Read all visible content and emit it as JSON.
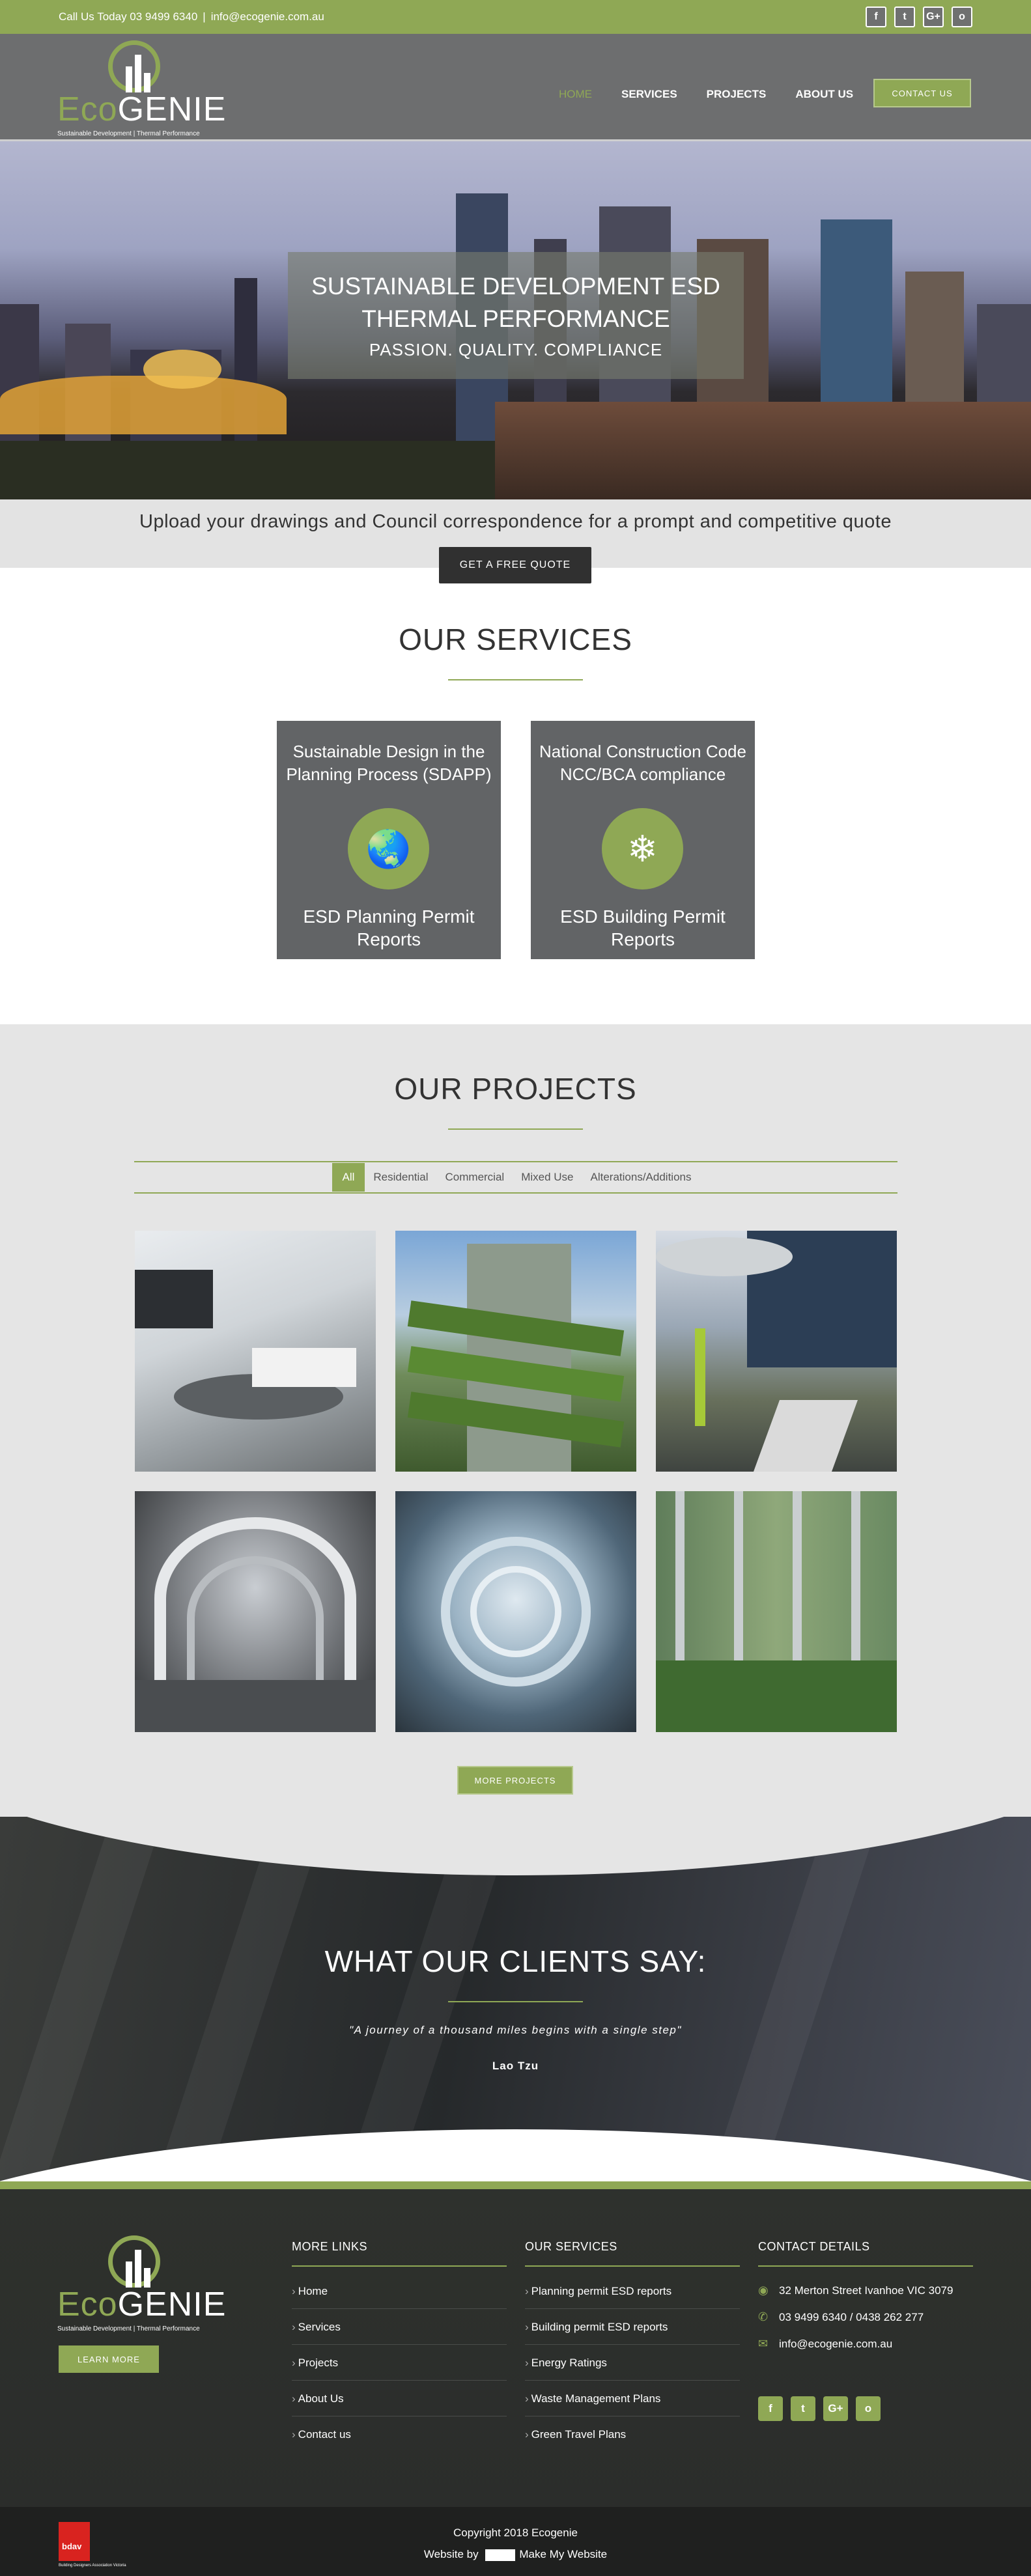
{
  "topbar": {
    "call_text": "Call Us Today 03 9499 6340",
    "email": "info@ecogenie.com.au",
    "social": [
      "f",
      "t",
      "G+",
      "o"
    ]
  },
  "logo": {
    "eco": "Eco",
    "genie": "GENIE",
    "tagline": "Sustainable Development | Thermal Performance"
  },
  "nav": {
    "items": [
      "HOME",
      "SERVICES",
      "PROJECTS",
      "ABOUT US"
    ],
    "contact_button": "CONTACT US"
  },
  "hero": {
    "title_line1": "SUSTAINABLE DEVELOPMENT ESD",
    "title_line2": "THERMAL PERFORMANCE",
    "subtitle": "PASSION. QUALITY. COMPLIANCE"
  },
  "quote": {
    "text": "Upload your drawings and Council correspondence for a prompt and competitive quote",
    "button": "GET A FREE QUOTE"
  },
  "services": {
    "heading": "OUR SERVICES",
    "cards": [
      {
        "top_line1": "Sustainable Design in the",
        "top_line2": "Planning Process (SDAPP)",
        "bottom_line1": "ESD Planning Permit",
        "bottom_line2": "Reports",
        "icon": "globe-icon"
      },
      {
        "top_line1": "National Construction Code",
        "top_line2": "NCC/BCA compliance",
        "bottom_line1": "ESD Building Permit",
        "bottom_line2": "Reports",
        "icon": "snowflake-icon"
      }
    ]
  },
  "projects": {
    "heading": "OUR PROJECTS",
    "filters": [
      "All",
      "Residential",
      "Commercial",
      "Mixed Use",
      "Alterations/Additions"
    ],
    "active_filter": "All",
    "more_button": "MORE PROJECTS"
  },
  "testimonials": {
    "heading": "WHAT OUR CLIENTS SAY:",
    "quote": "\"A journey of a thousand miles begins with a single step\"",
    "author": "Lao Tzu"
  },
  "footer": {
    "learn_more": "LEARN MORE",
    "more_links": {
      "heading": "MORE LINKS",
      "items": [
        "Home",
        "Services",
        "Projects",
        "About Us",
        "Contact us"
      ]
    },
    "our_services": {
      "heading": "OUR SERVICES",
      "items": [
        "Planning permit ESD reports",
        "Building permit ESD reports",
        "Energy Ratings",
        "Waste Management Plans",
        "Green Travel Plans"
      ]
    },
    "contact": {
      "heading": "CONTACT DETAILS",
      "address": "32 Merton Street Ivanhoe VIC 3079",
      "phone": "03 9499 6340 / 0438 262 277",
      "email": "info@ecogenie.com.au"
    },
    "copyright": "Copyright 2018 Ecogenie",
    "website_by": "Website by",
    "maker": "Make My Website",
    "bdav": "bdav",
    "bdav_sub": "Building Designers Association Victoria"
  },
  "colors": {
    "accent": "#8fa855",
    "header": "#6d6e6f",
    "card": "#626466"
  }
}
